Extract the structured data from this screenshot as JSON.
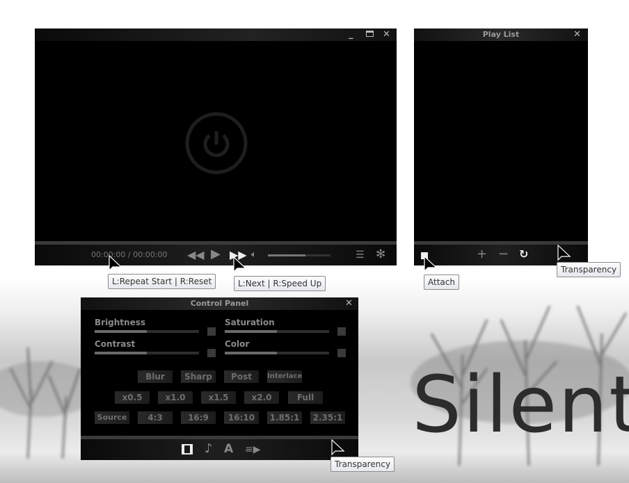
{
  "player": {
    "time_current": "00:00:00",
    "time_sep": "/",
    "time_total": "00:00:00",
    "volume_percent": 60,
    "icons": [
      "minimize-icon",
      "maximize-icon",
      "close-icon",
      "power-icon",
      "rewind-icon",
      "play-icon",
      "next-icon",
      "volume-icon",
      "playlist-icon",
      "gear-icon"
    ]
  },
  "playlist": {
    "title": "Play List"
  },
  "control_panel": {
    "title": "Control Panel",
    "sliders": [
      {
        "label": "Brightness",
        "value": 50
      },
      {
        "label": "Saturation",
        "value": 50
      },
      {
        "label": "Contrast",
        "value": 50
      },
      {
        "label": "Color",
        "value": 50
      }
    ],
    "row1": [
      "Blur",
      "Sharp",
      "Post",
      "Interlace"
    ],
    "row2": [
      "x0.5",
      "x1.0",
      "x1.5",
      "x2.0",
      "Full"
    ],
    "row3": [
      "Source",
      "4:3",
      "16:9",
      "16:10",
      "1.85:1",
      "2.35:1"
    ]
  },
  "tooltips": {
    "repeat": "L:Repeat Start | R:Reset",
    "next": "L:Next | R:Speed Up",
    "attach": "Attach",
    "transparency_playlist": "Transparency",
    "transparency_panel": "Transparency"
  },
  "brand": {
    "text": "Silent"
  },
  "colors": {
    "window": "#000000",
    "bar": "#1f1f1f",
    "text": "#8a8a8a"
  }
}
